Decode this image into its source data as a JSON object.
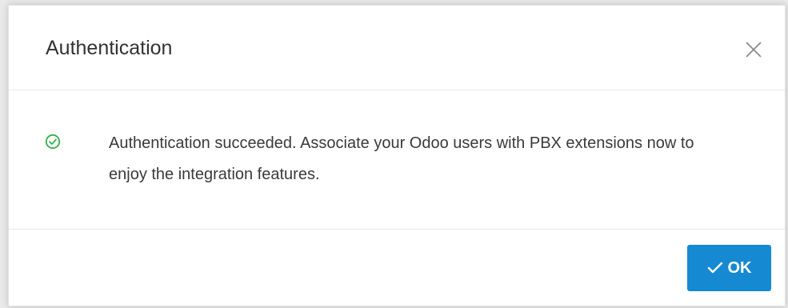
{
  "dialog": {
    "title": "Authentication",
    "message": "Authentication succeeded. Associate your Odoo users with PBX extensions now to enjoy the integration features.",
    "ok_label": "OK",
    "icons": {
      "close": "close-icon",
      "status": "check-circle-icon",
      "button": "check-icon"
    }
  },
  "colors": {
    "success": "#2fb34a",
    "primary": "#1689d3"
  }
}
